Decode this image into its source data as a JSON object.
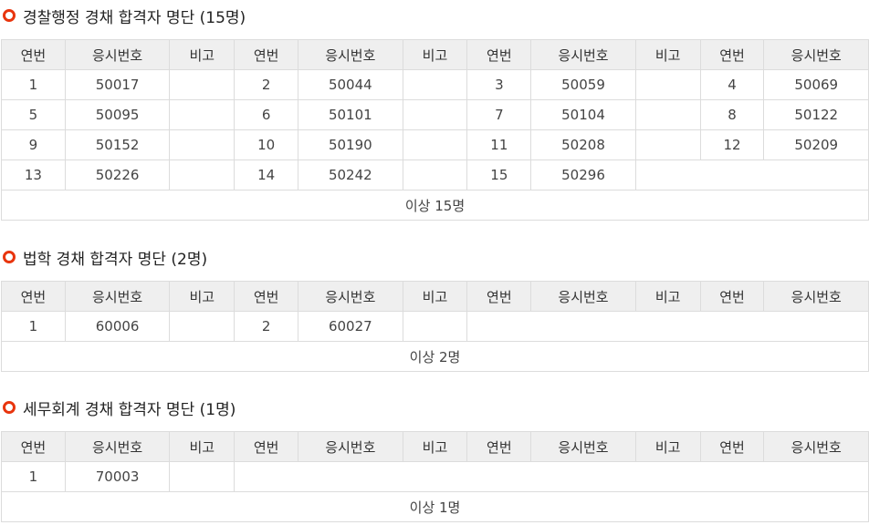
{
  "headers": [
    "연번",
    "응시번호",
    "비고",
    "연번",
    "응시번호",
    "비고",
    "연번",
    "응시번호",
    "비고",
    "연번",
    "응시번호"
  ],
  "sections": [
    {
      "title": "경찰행정 경채 합격자 명단 (15명)",
      "rows": [
        [
          "1",
          "50017",
          "",
          "2",
          "50044",
          "",
          "3",
          "50059",
          "",
          "4",
          "50069"
        ],
        [
          "5",
          "50095",
          "",
          "6",
          "50101",
          "",
          "7",
          "50104",
          "",
          "8",
          "50122"
        ],
        [
          "9",
          "50152",
          "",
          "10",
          "50190",
          "",
          "11",
          "50208",
          "",
          "12",
          "50209"
        ],
        [
          "13",
          "50226",
          "",
          "14",
          "50242",
          "",
          "15",
          "50296"
        ]
      ],
      "summary": "이상 15명"
    },
    {
      "title": "법학 경채 합격자 명단 (2명)",
      "rows": [
        [
          "1",
          "60006",
          "",
          "2",
          "60027",
          ""
        ]
      ],
      "summary": "이상 2명"
    },
    {
      "title": "세무회계 경채 합격자 명단 (1명)",
      "rows": [
        [
          "1",
          "70003",
          ""
        ]
      ],
      "summary": "이상 1명"
    }
  ]
}
